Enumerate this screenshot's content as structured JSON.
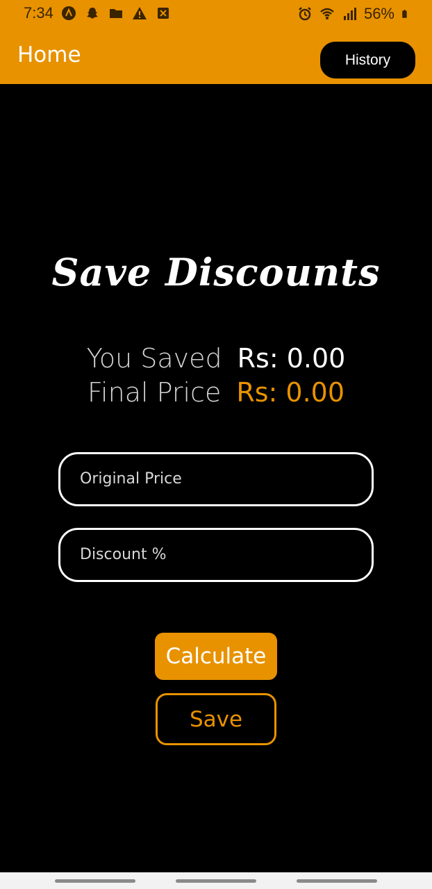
{
  "status_bar": {
    "time": "7:34",
    "battery": "56%",
    "left_icons": [
      "app-a-icon",
      "snapchat-icon",
      "folder-icon",
      "warning-icon",
      "x-box-icon"
    ],
    "right_icons": [
      "alarm-icon",
      "wifi-icon",
      "signal-icon",
      "battery-icon"
    ]
  },
  "appbar": {
    "title": "Home",
    "history_label": "History"
  },
  "main": {
    "headline": "Save Discounts",
    "you_saved_label": "You Saved",
    "you_saved_value": "Rs: 0.00",
    "final_price_label": "Final Price",
    "final_price_value": "Rs: 0.00",
    "original_price_placeholder": "Original Price",
    "discount_placeholder": "Discount %",
    "calculate_label": "Calculate",
    "save_label": "Save"
  },
  "colors": {
    "accent": "#E89200",
    "background": "#000000",
    "text": "#FFFFFF"
  }
}
